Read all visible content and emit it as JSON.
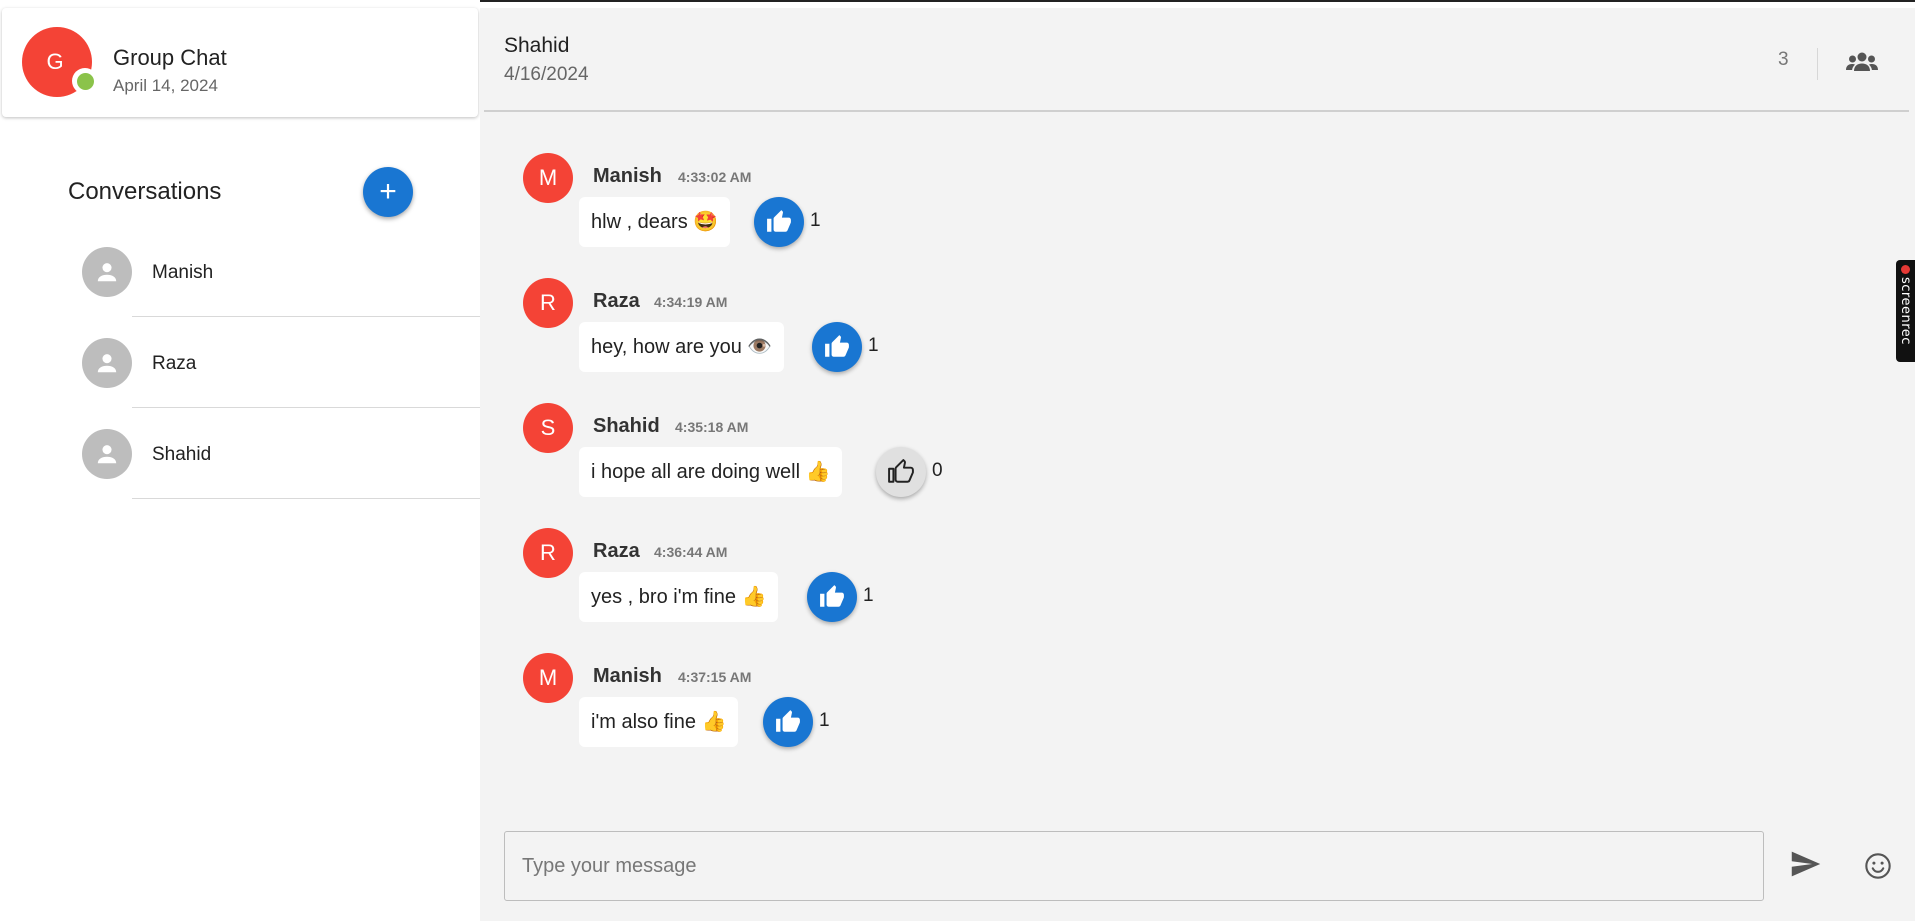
{
  "sidebar": {
    "group": {
      "avatar_letter": "G",
      "title": "Group Chat",
      "date": "April 14, 2024",
      "status_color": "#8bc34a"
    },
    "heading": "Conversations",
    "add_button_label": "+",
    "conversations": [
      {
        "name": "Manish"
      },
      {
        "name": "Raza"
      },
      {
        "name": "Shahid"
      }
    ]
  },
  "chat": {
    "header": {
      "name": "Shahid",
      "date": "4/16/2024",
      "member_count": "3"
    },
    "messages": [
      {
        "avatar_letter": "M",
        "author": "Manish",
        "time": "4:33:02 AM",
        "text": "hlw , dears 🤩",
        "likes": "1",
        "liked": true
      },
      {
        "avatar_letter": "R",
        "author": "Raza",
        "time": "4:34:19 AM",
        "text": "hey, how are you 👁️",
        "likes": "1",
        "liked": true
      },
      {
        "avatar_letter": "S",
        "author": "Shahid",
        "time": "4:35:18 AM",
        "text": "i hope all are doing well 👍",
        "likes": "0",
        "liked": false
      },
      {
        "avatar_letter": "R",
        "author": "Raza",
        "time": "4:36:44 AM",
        "text": "yes , bro i'm fine 👍",
        "likes": "1",
        "liked": true
      },
      {
        "avatar_letter": "M",
        "author": "Manish",
        "time": "4:37:15 AM",
        "text": "i'm also fine 👍",
        "likes": "1",
        "liked": true
      }
    ],
    "composer": {
      "placeholder": "Type your message",
      "value": ""
    }
  },
  "overlay": {
    "recorder_label": "screenrec"
  },
  "colors": {
    "accent": "#1976d2",
    "avatar_red": "#f44336",
    "chat_bg": "#f3f3f3"
  },
  "icons": [
    "plus-icon",
    "person-icon",
    "group-icon",
    "thumb-up-icon",
    "send-icon",
    "emoji-icon"
  ]
}
